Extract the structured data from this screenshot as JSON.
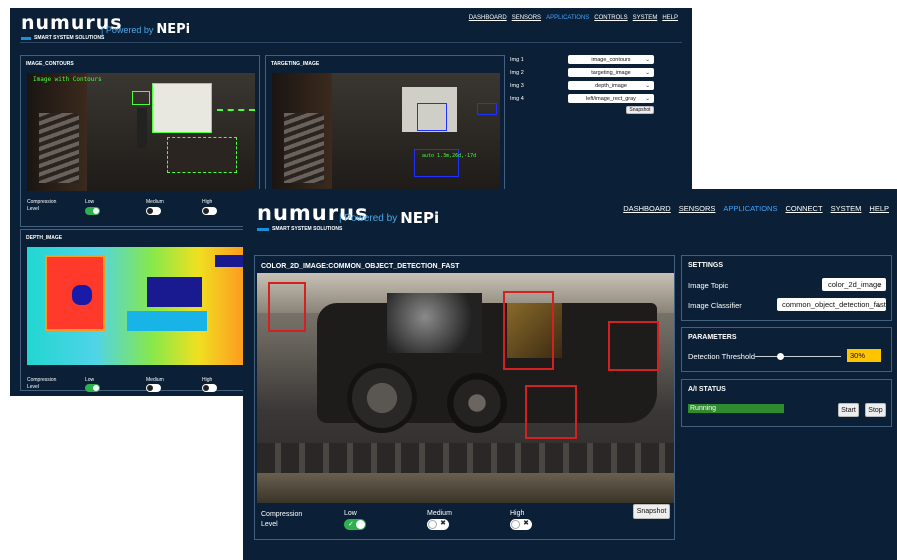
{
  "back_window": {
    "logo": {
      "word": "numurus",
      "tagline": "SMART SYSTEM SOLUTIONS"
    },
    "powered_by": {
      "text": "Powered by",
      "brand": "NEPi"
    },
    "nav": [
      "DASHBOARD",
      "SENSORS",
      "APPLICATIONS",
      "CONTROLS",
      "SYSTEM",
      "HELP"
    ],
    "nav_active": "APPLICATIONS",
    "panels": {
      "contours": {
        "title": "IMAGE_CONTOURS",
        "overlay": "Image with Contours"
      },
      "targeting": {
        "title": "TARGETING_IMAGE",
        "overlay": "auto 1.3m,26d,-17d"
      },
      "depth": {
        "title": "DEPTH_IMAGE"
      }
    },
    "compression": {
      "label": "Compression Level",
      "low": "Low",
      "medium": "Medium",
      "high": "High",
      "selected": "Low"
    },
    "image_selects": [
      {
        "label": "Img 1",
        "value": "image_contours"
      },
      {
        "label": "Img 2",
        "value": "targeting_image"
      },
      {
        "label": "Img 3",
        "value": "depth_image"
      },
      {
        "label": "Img 4",
        "value": "left/image_rect_gray"
      }
    ],
    "snapshot": "Snapshot"
  },
  "front_window": {
    "logo": {
      "word": "numurus",
      "tagline": "SMART SYSTEM SOLUTIONS"
    },
    "powered_by": {
      "text": "Powered by",
      "brand": "NEPi"
    },
    "nav": [
      "DASHBOARD",
      "SENSORS",
      "APPLICATIONS",
      "CONNECT",
      "SYSTEM",
      "HELP"
    ],
    "nav_active": "APPLICATIONS",
    "image_panel": {
      "title": "COLOR_2D_IMAGE:COMMON_OBJECT_DETECTION_FAST"
    },
    "compression": {
      "label": "Compression Level",
      "low": "Low",
      "medium": "Medium",
      "high": "High",
      "selected": "Low"
    },
    "snapshot": "Snapshot",
    "settings": {
      "title": "SETTINGS",
      "image_topic_label": "Image Topic",
      "image_topic_value": "color_2d_image",
      "classifier_label": "Image Classifier",
      "classifier_value": "common_object_detection_fast"
    },
    "parameters": {
      "title": "PARAMETERS",
      "threshold_label": "Detection Threshold",
      "threshold_value": "30%",
      "threshold_fraction": 0.3
    },
    "ai_status": {
      "title": "A/I STATUS",
      "status_text": "Running",
      "start": "Start",
      "stop": "Stop"
    }
  },
  "colors": {
    "bg": "#0b2036",
    "accent": "#3fa4ff",
    "toggle_on": "#2eb04e",
    "status": "#2e8b2e",
    "threshold_box": "#ffc400",
    "bbox": "#d42020"
  }
}
